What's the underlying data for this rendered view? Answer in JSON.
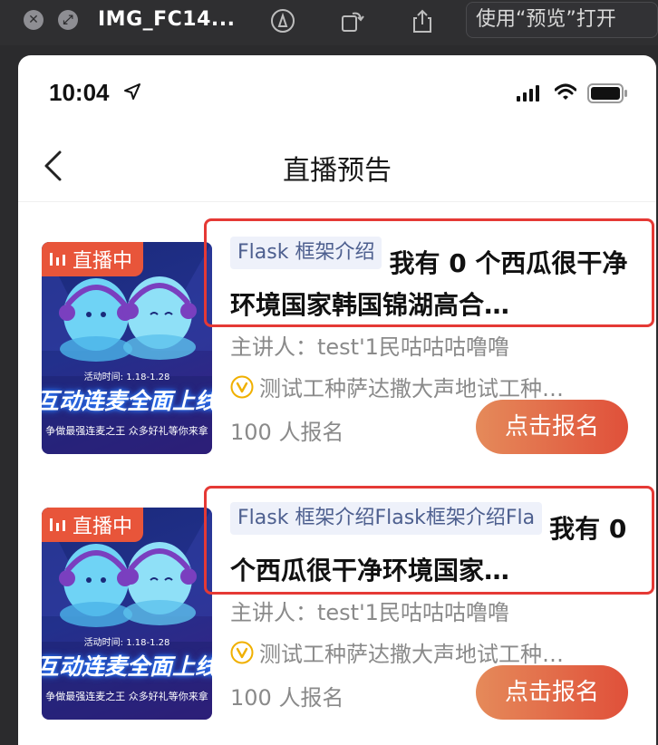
{
  "toolbar": {
    "title": "IMG_FC14...",
    "open_button": "使用“预览”打开",
    "icons": [
      "close-icon",
      "fullscreen-icon",
      "markup-icon",
      "rotate-icon",
      "share-icon"
    ]
  },
  "status_bar": {
    "time": "10:04"
  },
  "nav": {
    "title": "直播预告"
  },
  "cards": [
    {
      "badge": "直播中",
      "thumb_date": "活动时间: 1.18-1.28",
      "thumb_headline": "互动连麦全面上线",
      "thumb_sub": "争做最强连麦之王  众多好礼等你来拿",
      "tag": "Flask 框架介绍",
      "title": "我有 0 个西瓜很干净环境国家韩国锦湖高合…",
      "speaker": "主讲人：test'1民咕咕咕噜噜",
      "desc": "测试工种萨达撒大声地试工种…",
      "count": "100 人报名",
      "button": "点击报名"
    },
    {
      "badge": "直播中",
      "thumb_date": "活动时间: 1.18-1.28",
      "thumb_headline": "互动连麦全面上线",
      "thumb_sub": "争做最强连麦之王  众多好礼等你来拿",
      "tag": "Flask 框架介绍Flask框架介绍Fla",
      "title": "我有 0 个西瓜很干净环境国家…",
      "speaker": "主讲人：test'1民咕咕咕噜噜",
      "desc": "测试工种萨达撒大声地试工种…",
      "count": "100 人报名",
      "button": "点击报名"
    }
  ],
  "colors": {
    "accent": "#e0503a",
    "highlight_border": "#e53935",
    "tag_bg": "#eef1fa",
    "tag_text": "#4d5f8f"
  }
}
